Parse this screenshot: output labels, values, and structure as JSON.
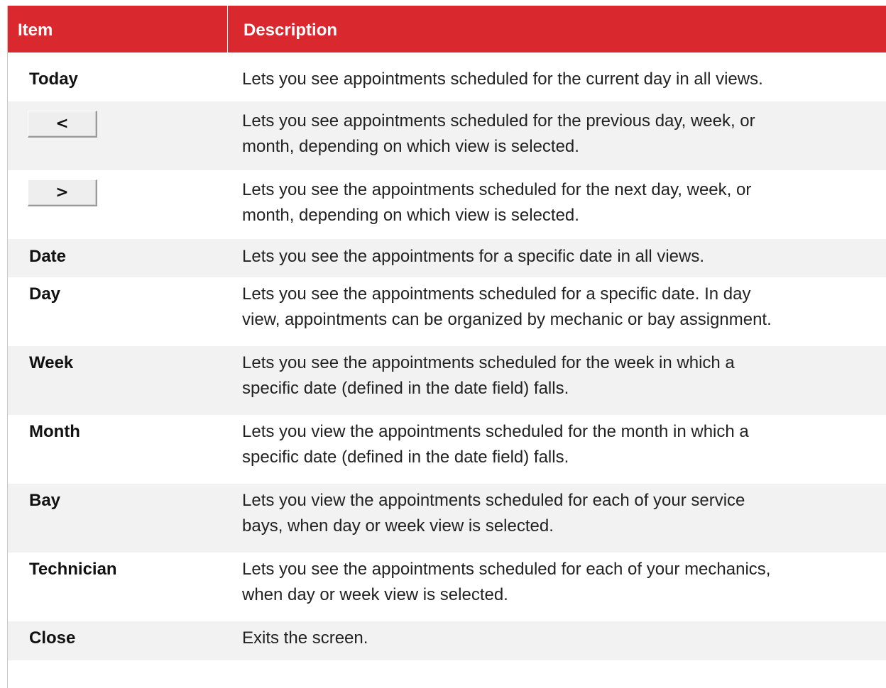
{
  "header": {
    "item": "Item",
    "description": "Description"
  },
  "rows": [
    {
      "item": "Today",
      "description_lines": [
        "Lets you see appointments scheduled for the current day in all views."
      ]
    },
    {
      "item_button": "<",
      "description_lines": [
        "Lets you see appointments scheduled for the previous day, week, or",
        "month, depending on which view is selected."
      ]
    },
    {
      "item_button": ">",
      "description_lines": [
        "Lets you see the appointments scheduled for the next day, week, or",
        "month, depending on which view is selected."
      ]
    },
    {
      "item": "Date",
      "description_lines": [
        "Lets you see the appointments for a specific date in all views."
      ]
    },
    {
      "item": "Day",
      "description_lines": [
        "Lets you see the appointments scheduled for a specific date. In day",
        "view, appointments can be organized by mechanic or bay assignment."
      ]
    },
    {
      "item": "Week",
      "description_lines": [
        "Lets you see the appointments scheduled for the week in which a",
        "specific date (defined in the date field) falls."
      ]
    },
    {
      "item": "Month",
      "description_lines": [
        "Lets you view the appointments scheduled for the month in which a",
        "specific date (defined in the date field) falls."
      ]
    },
    {
      "item": "Bay",
      "description_lines": [
        "Lets you view the appointments scheduled for each of your service",
        "bays, when day or week view is selected."
      ]
    },
    {
      "item": "Technician",
      "description_lines": [
        "Lets you see the appointments scheduled for each of your mechanics,",
        "when day or week view is selected."
      ]
    },
    {
      "item": "Close",
      "description_lines": [
        "Exits the screen."
      ]
    }
  ],
  "colors": {
    "header_bg": "#d9292f",
    "header_text": "#ffffff",
    "row_shade": "#f2f2f2",
    "text": "#222222"
  }
}
